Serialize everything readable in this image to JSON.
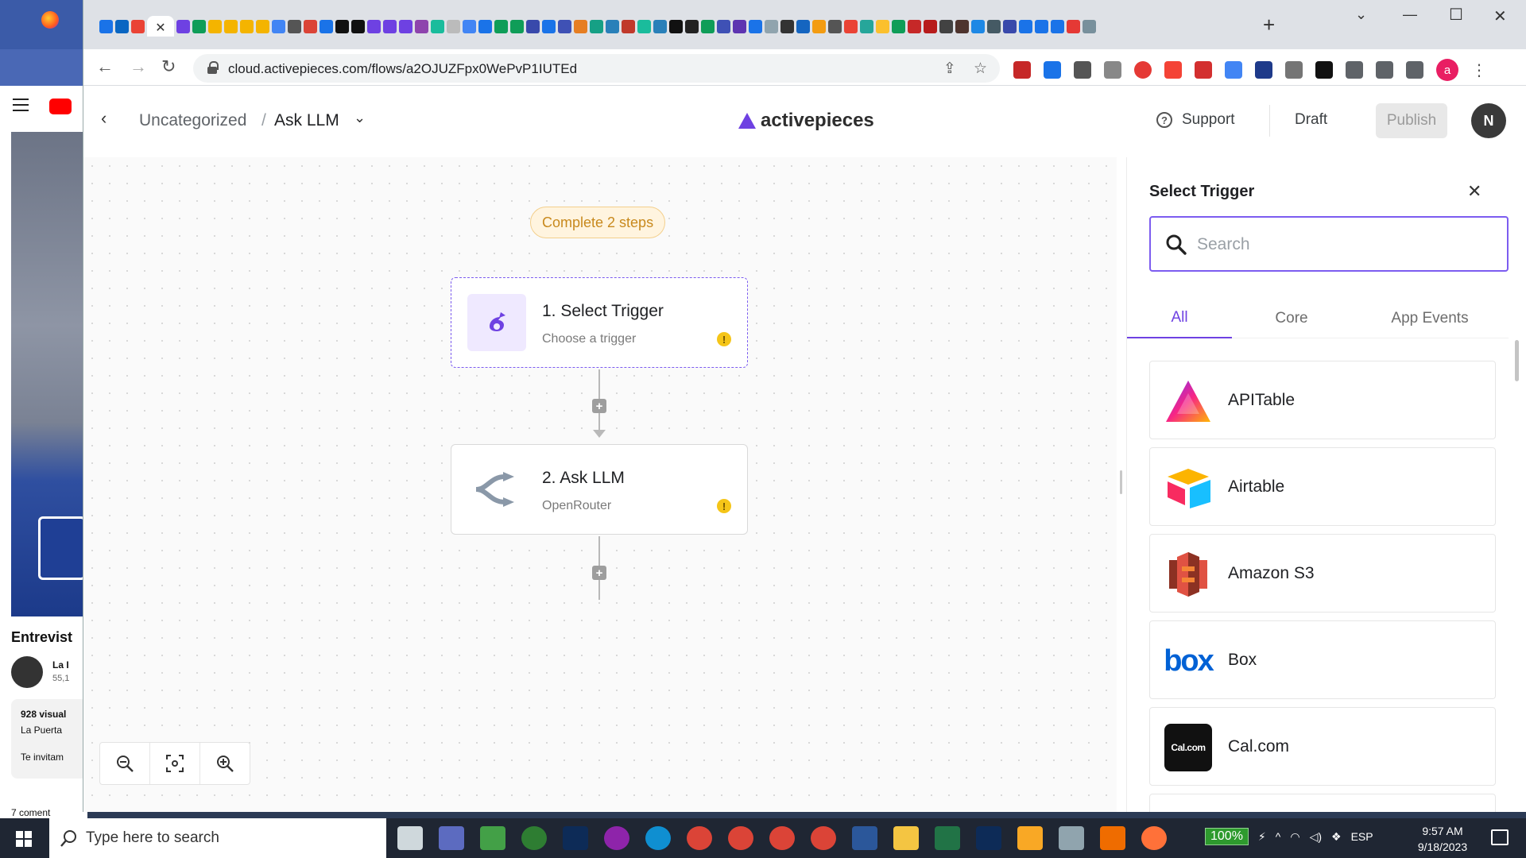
{
  "background_page": {
    "video_title": "Entrevist",
    "channel_name": "La I",
    "subscribers": "55,1",
    "views": "928 visual",
    "desc_line1": "La Puerta",
    "desc_line2": "Te invitam",
    "comments": "7 coment"
  },
  "browser": {
    "url_host": "cloud.activepieces.com",
    "url_path": "/flows/a2OJUZFpx0WePvP1IUTEd",
    "active_tab_close": "✕",
    "new_tab": "+",
    "profile_initial": "a"
  },
  "header": {
    "breadcrumb_folder": "Uncategorized",
    "breadcrumb_sep": "/",
    "flow_name": "Ask LLM",
    "brand": "activepieces",
    "support_label": "Support",
    "status_label": "Draft",
    "publish_label": "Publish",
    "user_initial": "N"
  },
  "canvas": {
    "steps_badge": "Complete 2 steps",
    "trigger": {
      "title": "1. Select Trigger",
      "subtitle": "Choose a trigger"
    },
    "step2": {
      "title": "2. Ask LLM",
      "subtitle": "OpenRouter"
    }
  },
  "panel": {
    "title": "Select Trigger",
    "search_placeholder": "Search",
    "tabs": [
      {
        "label": "All",
        "active": true
      },
      {
        "label": "Core",
        "active": false
      },
      {
        "label": "App Events",
        "active": false
      }
    ],
    "pieces": [
      {
        "name": "APITable",
        "icon": "apitable-icon"
      },
      {
        "name": "Airtable",
        "icon": "airtable-icon"
      },
      {
        "name": "Amazon S3",
        "icon": "amazon-s3-icon"
      },
      {
        "name": "Box",
        "icon": "box-icon"
      },
      {
        "name": "Cal.com",
        "icon": "calcom-icon"
      }
    ],
    "calcom_logo_text": "Cal.com",
    "box_logo_text": "box"
  },
  "taskbar": {
    "search_placeholder": "Type here to search",
    "battery": "100%",
    "language": "ESP",
    "time": "9:57 AM",
    "date": "9/18/2023"
  },
  "colors": {
    "accent": "#6e41e2",
    "warning": "#f5c518",
    "badge_text": "#c8891d"
  }
}
